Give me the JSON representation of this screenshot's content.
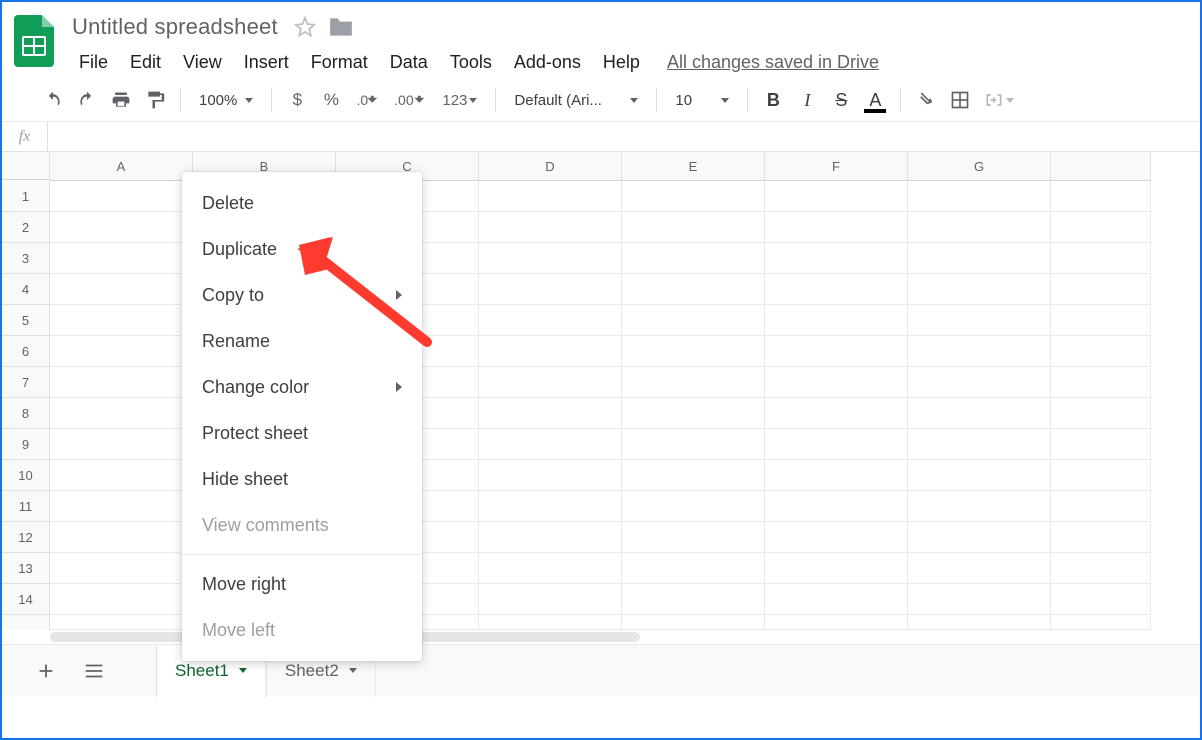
{
  "header": {
    "doc_title": "Untitled spreadsheet",
    "saved_status": "All changes saved in Drive"
  },
  "menubar": {
    "items": [
      "File",
      "Edit",
      "View",
      "Insert",
      "Format",
      "Data",
      "Tools",
      "Add-ons",
      "Help"
    ]
  },
  "toolbar": {
    "zoom": "100%",
    "font": "Default (Ari...",
    "font_size": "10",
    "decimal_decrease": ".0",
    "decimal_increase": ".00",
    "number_format": "123",
    "currency": "$",
    "percent": "%",
    "bold": "B",
    "italic": "I",
    "strike": "S",
    "text_color": "A"
  },
  "formula_bar": {
    "fx": "fx",
    "value": ""
  },
  "grid": {
    "columns": [
      "A",
      "B",
      "C",
      "D",
      "E",
      "F",
      "G"
    ],
    "rows": [
      "1",
      "2",
      "3",
      "4",
      "5",
      "6",
      "7",
      "8",
      "9",
      "10",
      "11",
      "12",
      "13",
      "14"
    ]
  },
  "sheet_tabs": {
    "tabs": [
      {
        "label": "Sheet1",
        "active": true
      },
      {
        "label": "Sheet2",
        "active": false
      }
    ]
  },
  "context_menu": {
    "items": [
      {
        "label": "Delete",
        "submenu": false,
        "disabled": false
      },
      {
        "label": "Duplicate",
        "submenu": false,
        "disabled": false
      },
      {
        "label": "Copy to",
        "submenu": true,
        "disabled": false
      },
      {
        "label": "Rename",
        "submenu": false,
        "disabled": false
      },
      {
        "label": "Change color",
        "submenu": true,
        "disabled": false
      },
      {
        "label": "Protect sheet",
        "submenu": false,
        "disabled": false
      },
      {
        "label": "Hide sheet",
        "submenu": false,
        "disabled": false
      },
      {
        "label": "View comments",
        "submenu": false,
        "disabled": true
      },
      {
        "separator": true
      },
      {
        "label": "Move right",
        "submenu": false,
        "disabled": false
      },
      {
        "label": "Move left",
        "submenu": false,
        "disabled": true
      }
    ]
  },
  "annotation": {
    "arrow_color": "#ff3b30",
    "target": "context-menu-duplicate"
  }
}
